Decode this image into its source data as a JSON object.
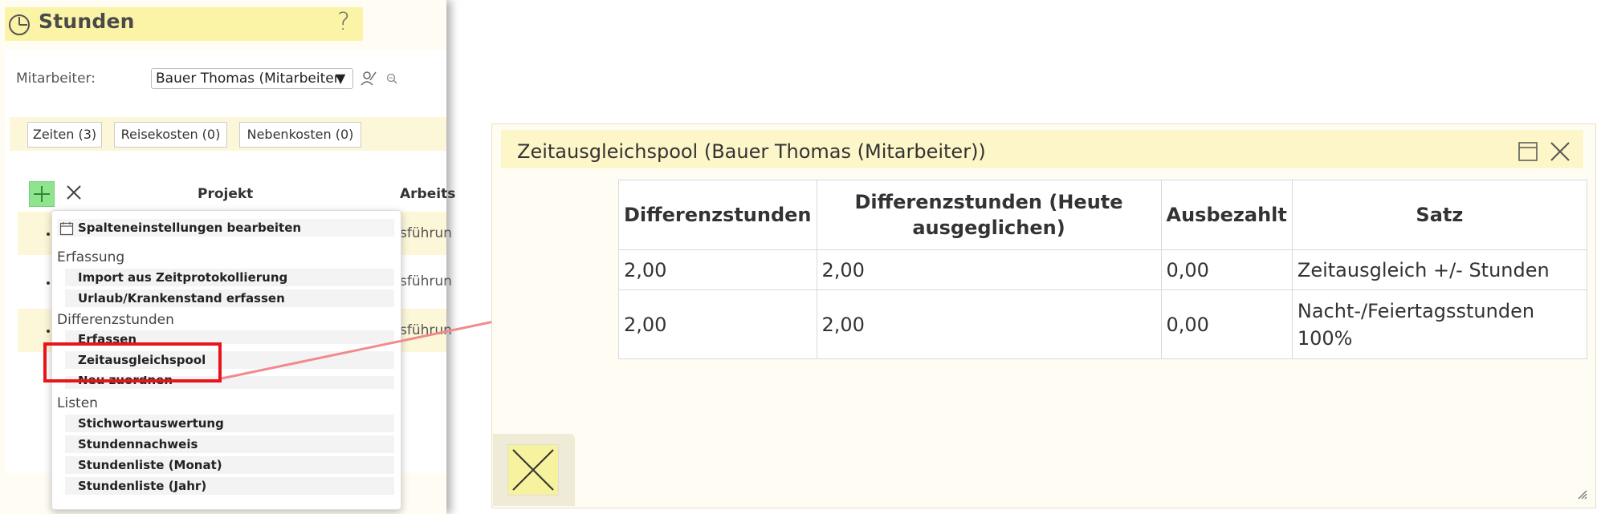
{
  "panel": {
    "title": "Stunden",
    "help": "?",
    "employee_label": "Mitarbeiter:",
    "employee_value": "Bauer Thomas (Mitarbeiter",
    "tabs": [
      {
        "label": "Zeiten (3)"
      },
      {
        "label": "Reisekosten (0)"
      },
      {
        "label": "Nebenkosten (0)"
      }
    ],
    "columns": {
      "projekt": "Projekt",
      "arbeits": "Arbeits"
    },
    "rows": [
      {
        "text": "sführun"
      },
      {
        "text": "sführun"
      },
      {
        "text": "sführun"
      }
    ]
  },
  "menu": {
    "column_settings": "Spalteneinstellungen bearbeiten",
    "groups": {
      "erfassung": "Erfassung",
      "differenz": "Differenzstunden",
      "listen": "Listen"
    },
    "items": {
      "import": "Import aus Zeitprotokollierung",
      "urlaub": "Urlaub/Krankenstand erfassen",
      "erfassen": "Erfassen",
      "pool": "Zeitausgleichspool",
      "neu": "Neu zuordnen",
      "stichwort": "Stichwortauswertung",
      "nachweis": "Stundennachweis",
      "monat": "Stundenliste (Monat)",
      "jahr": "Stundenliste (Jahr)"
    }
  },
  "dialog": {
    "title": "Zeitausgleichspool (Bauer Thomas (Mitarbeiter))",
    "headers": {
      "diff": "Differenzstunden",
      "heute_1": "Differenzstunden (Heute",
      "heute_2": "ausgeglichen)",
      "ausbezahlt": "Ausbezahlt",
      "satz": "Satz"
    },
    "rows": [
      {
        "diff": "2,00",
        "heute": "2,00",
        "ausbezahlt": "0,00",
        "satz_1": "Zeitausgleich +/- Stunden",
        "satz_2": ""
      },
      {
        "diff": "2,00",
        "heute": "2,00",
        "ausbezahlt": "0,00",
        "satz_1": "Nacht-/Feiertagsstunden",
        "satz_2": "100%"
      }
    ]
  },
  "colors": {
    "title_yellow": "#fbf4a6",
    "add_green": "#8ee58e",
    "highlight_red": "#e8141b",
    "arrow_pink": "#f08b8b"
  }
}
